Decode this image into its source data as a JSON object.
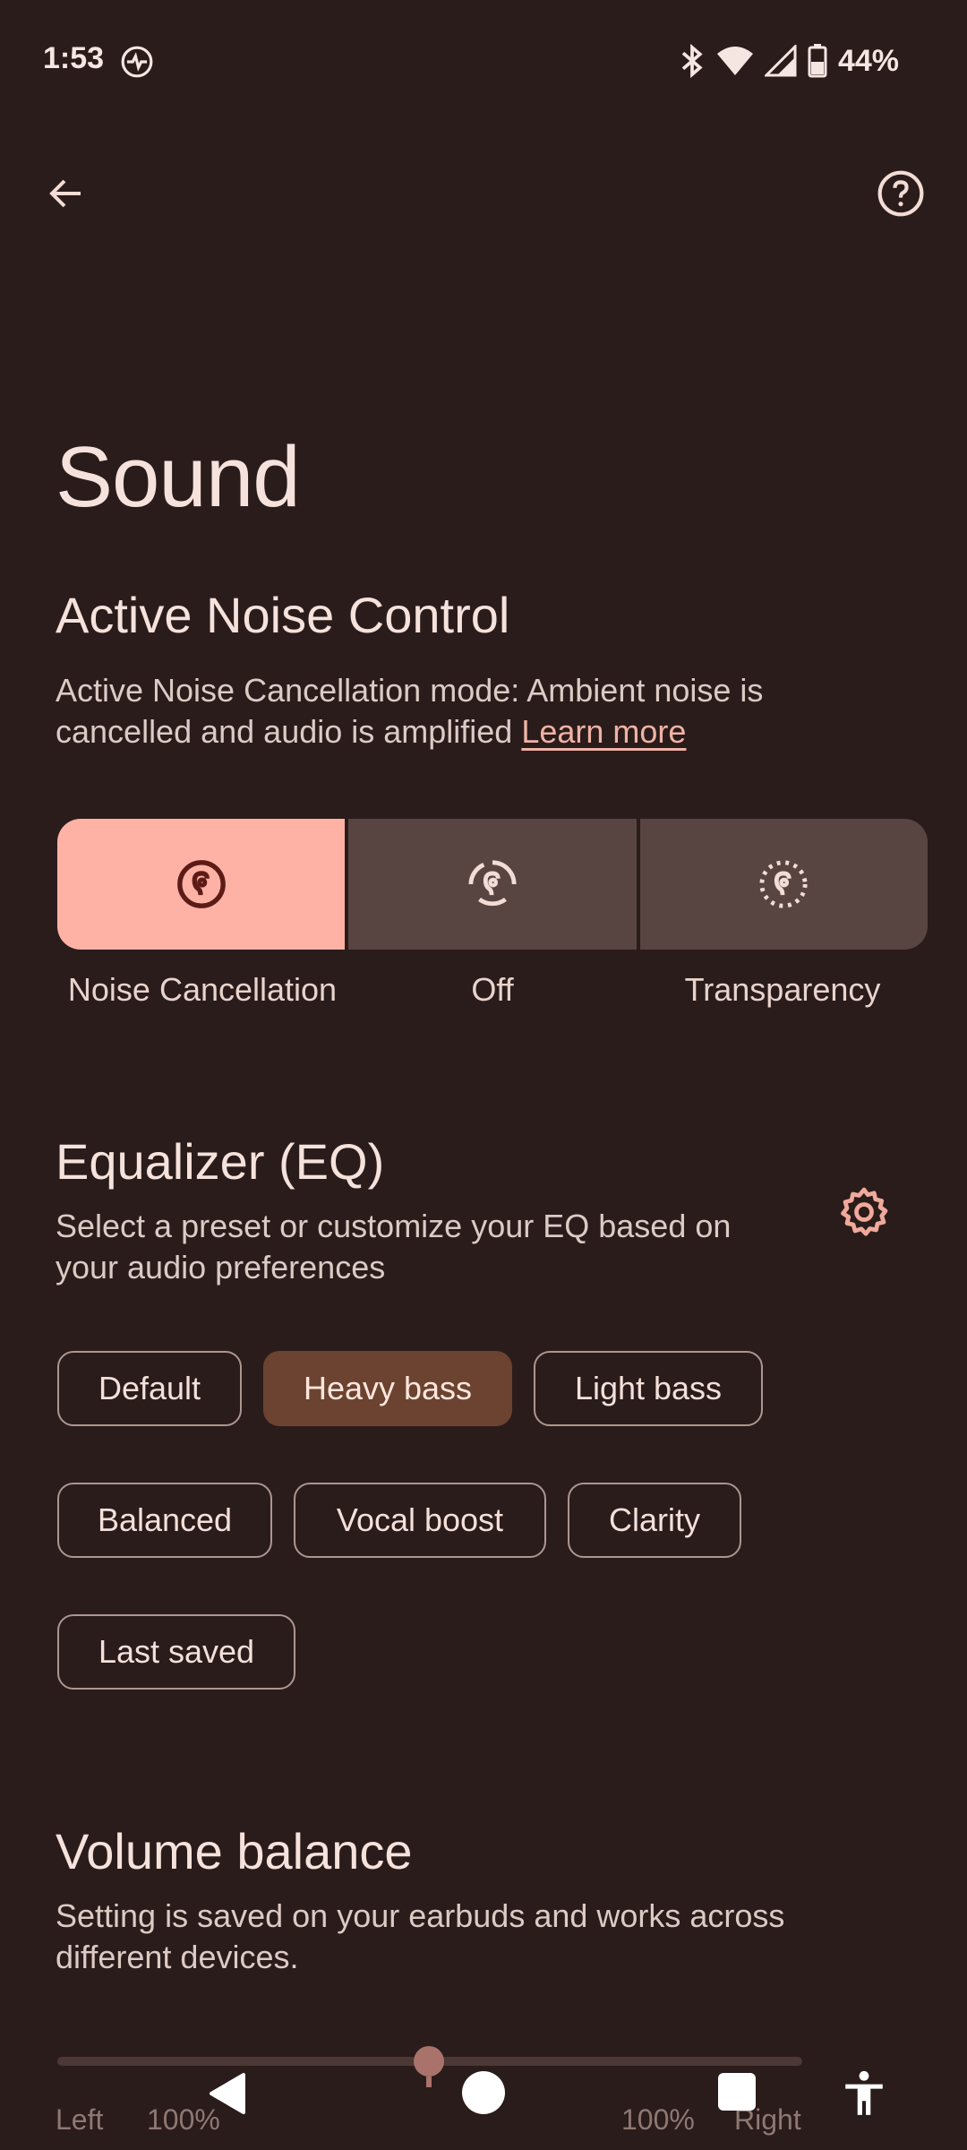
{
  "status_bar": {
    "time": "1:53",
    "battery_percent": "44%",
    "icons": [
      "activity-icon",
      "bluetooth-icon",
      "wifi-icon",
      "cell-signal-icon",
      "battery-icon"
    ]
  },
  "app_bar": {
    "back_icon": "arrow-left-icon",
    "help_icon": "help-circle-icon"
  },
  "page": {
    "title": "Sound"
  },
  "anc": {
    "title": "Active Noise Control",
    "description": "Active Noise Cancellation mode: Ambient noise is cancelled and audio is amplified",
    "learn_more": "Learn more",
    "modes": [
      {
        "label": "Noise Cancellation",
        "icon": "noise-cancellation-icon",
        "selected": true
      },
      {
        "label": "Off",
        "icon": "anc-off-icon",
        "selected": false
      },
      {
        "label": "Transparency",
        "icon": "transparency-icon",
        "selected": false
      }
    ]
  },
  "eq": {
    "title": "Equalizer (EQ)",
    "description": "Select a preset or customize your EQ based on your audio preferences",
    "settings_icon": "gear-icon",
    "presets": [
      {
        "label": "Default",
        "selected": false
      },
      {
        "label": "Heavy bass",
        "selected": true
      },
      {
        "label": "Light bass",
        "selected": false
      },
      {
        "label": "Balanced",
        "selected": false
      },
      {
        "label": "Vocal boost",
        "selected": false
      },
      {
        "label": "Clarity",
        "selected": false
      },
      {
        "label": "Last saved",
        "selected": false
      }
    ]
  },
  "volume_balance": {
    "title": "Volume balance",
    "description": "Setting is saved on your earbuds and works across different devices.",
    "left_label": "Left",
    "left_value": "100%",
    "right_value": "100%",
    "right_label": "Right",
    "balance_fraction": 0.5
  },
  "nav_bar": {
    "icons": [
      "nav-back-icon",
      "nav-home-icon",
      "nav-recents-icon",
      "accessibility-icon"
    ]
  },
  "colors": {
    "background": "#2a1c1a",
    "accent": "#fdb2a5",
    "chip_selected": "#6b4330",
    "segment": "#584441",
    "link": "#f0b2a6"
  }
}
